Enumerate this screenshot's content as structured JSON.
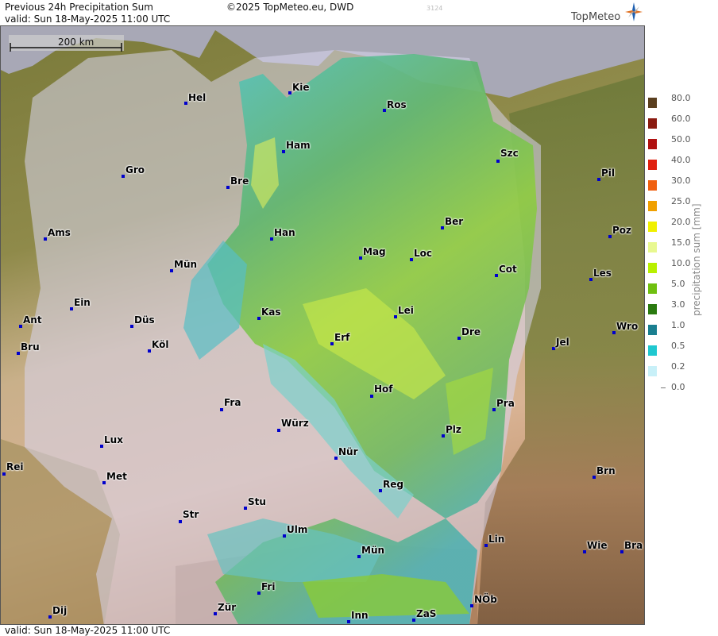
{
  "header": {
    "title": "Previous 24h Precipitation Sum",
    "valid": "valid:  Sun  18-May-2025 11:00 UTC",
    "copyright": "©2025 TopMeteo.eu, DWD",
    "code": "3124",
    "brand": "TopMeteo"
  },
  "footer": {
    "valid": "valid:  Sun  18-May-2025 11:00 UTC"
  },
  "scale_bar": {
    "label": "200 km"
  },
  "legend": {
    "title": "precipitation sum [mm]",
    "entries": [
      {
        "label": "80.0",
        "color": "#5a3f1f"
      },
      {
        "label": "60.0",
        "color": "#8a1a10"
      },
      {
        "label": "50.0",
        "color": "#b01010"
      },
      {
        "label": "40.0",
        "color": "#e02010"
      },
      {
        "label": "30.0",
        "color": "#f06010"
      },
      {
        "label": "25.0",
        "color": "#f0a000"
      },
      {
        "label": "20.0",
        "color": "#f0f000"
      },
      {
        "label": "15.0",
        "color": "#e8f890"
      },
      {
        "label": "10.0",
        "color": "#b8f000"
      },
      {
        "label": "5.0",
        "color": "#70c010"
      },
      {
        "label": "3.0",
        "color": "#2a7a10"
      },
      {
        "label": "1.0",
        "color": "#1a7f90"
      },
      {
        "label": "0.5",
        "color": "#20c8d0"
      },
      {
        "label": "0.2",
        "color": "#c8f0f8"
      },
      {
        "label": "0.0",
        "color": "#ffffff"
      }
    ]
  },
  "cities": [
    {
      "name": "Hel"
    },
    {
      "name": "Kie"
    },
    {
      "name": "Ros"
    },
    {
      "name": "Ham"
    },
    {
      "name": "Szc"
    },
    {
      "name": "Gro"
    },
    {
      "name": "Bre"
    },
    {
      "name": "Pil"
    },
    {
      "name": "Ber"
    },
    {
      "name": "Ams"
    },
    {
      "name": "Han"
    },
    {
      "name": "Poz"
    },
    {
      "name": "Mag"
    },
    {
      "name": "Loc"
    },
    {
      "name": "Mün"
    },
    {
      "name": "Cot"
    },
    {
      "name": "Les"
    },
    {
      "name": "Ein"
    },
    {
      "name": "Lei"
    },
    {
      "name": "Kas"
    },
    {
      "name": "Ant"
    },
    {
      "name": "Düs"
    },
    {
      "name": "Wro"
    },
    {
      "name": "Dre"
    },
    {
      "name": "Erf"
    },
    {
      "name": "Bru"
    },
    {
      "name": "Köl"
    },
    {
      "name": "Jel"
    },
    {
      "name": "Hof"
    },
    {
      "name": "Fra"
    },
    {
      "name": "Pra"
    },
    {
      "name": "Würz"
    },
    {
      "name": "Plz"
    },
    {
      "name": "Lux"
    },
    {
      "name": "Nür"
    },
    {
      "name": "Rei"
    },
    {
      "name": "Brn"
    },
    {
      "name": "Met"
    },
    {
      "name": "Reg"
    },
    {
      "name": "Stu"
    },
    {
      "name": "Str"
    },
    {
      "name": "Ulm"
    },
    {
      "name": "Lin"
    },
    {
      "name": "Mün"
    },
    {
      "name": "Wie"
    },
    {
      "name": "Bra"
    },
    {
      "name": "Fri"
    },
    {
      "name": "NÖb"
    },
    {
      "name": "Dij"
    },
    {
      "name": "Zür"
    },
    {
      "name": "Inn"
    },
    {
      "name": "ZaS"
    }
  ]
}
